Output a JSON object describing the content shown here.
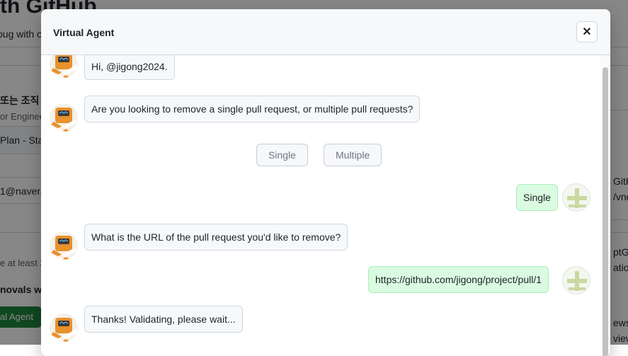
{
  "background": {
    "title": "th GitHub",
    "subtitle": "oug with c",
    "org_label": "또는 조직 ·",
    "role": "or Engineer",
    "plan": "Plan - Sta",
    "email": "1@naver.",
    "hint": "e at least 3",
    "approvals": "novals wi",
    "virtual_agent_button": "al Agent",
    "right_1": "GitH",
    "right_2": "/vnd",
    "right_3": "ptG",
    "right_4": "ation",
    "right_5": "ews",
    "right_6": "view"
  },
  "modal": {
    "title": "Virtual Agent",
    "close_label": "✕"
  },
  "chat": {
    "bot_avatar_label": "HI-BOT",
    "messages": [
      {
        "from": "bot",
        "text": "Hi, @jigong2024."
      },
      {
        "from": "bot",
        "text": "Are you looking to remove a single pull request, or multiple pull requests?"
      },
      {
        "from": "user",
        "text": "Single"
      },
      {
        "from": "bot",
        "text": "What is the URL of the pull request you'd like to remove?"
      },
      {
        "from": "user",
        "text": "https://github.com/jigong/project/pull/1"
      },
      {
        "from": "bot",
        "text": "Thanks! Validating, please wait..."
      }
    ],
    "choices": [
      "Single",
      "Multiple"
    ]
  },
  "colors": {
    "bot_bubble": "#f6f8fa",
    "user_bubble": "#dafbe1",
    "bot_avatar": "#e8912d",
    "user_avatar_mark": "#c9d9a0"
  }
}
